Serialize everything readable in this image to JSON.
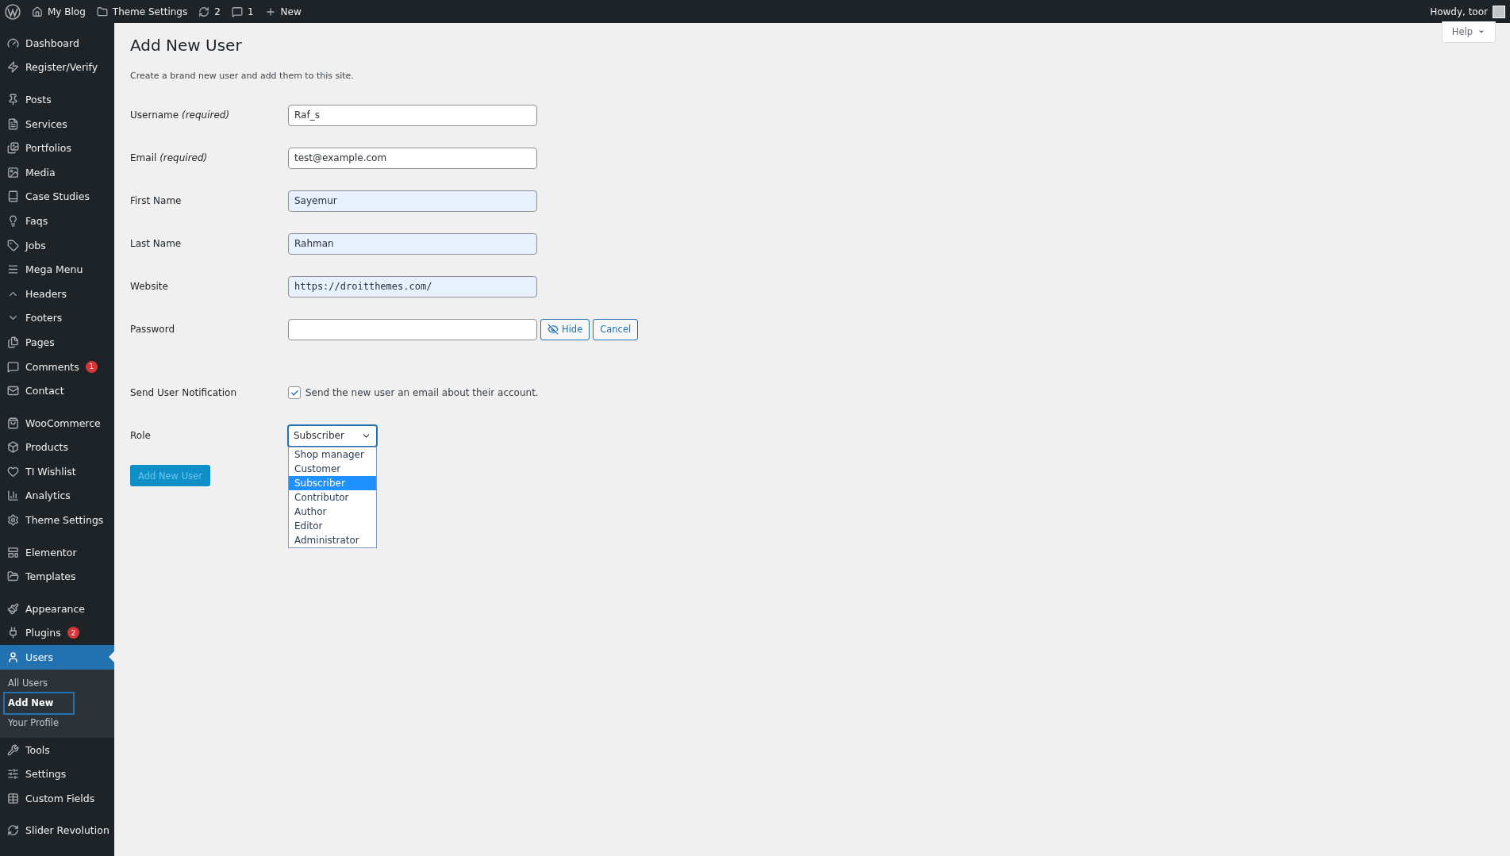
{
  "admin_bar": {
    "items": [
      {
        "kind": "home",
        "label": "My Blog"
      },
      {
        "kind": "folder",
        "label": "Theme Settings"
      },
      {
        "kind": "updates",
        "label": "2"
      },
      {
        "kind": "comments",
        "label": "1"
      },
      {
        "kind": "new",
        "label": "New"
      }
    ],
    "account": "Howdy, toor"
  },
  "help_tab": "Help",
  "sidebar": {
    "groups": [
      {
        "items": [
          {
            "kind": "gauge",
            "label": "Dashboard",
            "selected": false
          },
          {
            "kind": "bolt",
            "label": "Register/Verify",
            "selected": false
          }
        ]
      },
      {
        "items": [
          {
            "kind": "pin",
            "label": "Posts",
            "selected": false
          },
          {
            "kind": "doc",
            "label": "Services",
            "selected": false
          },
          {
            "kind": "images",
            "label": "Portfolios",
            "selected": false
          },
          {
            "kind": "media",
            "label": "Media",
            "selected": false
          },
          {
            "kind": "book",
            "label": "Case Studies",
            "selected": false
          },
          {
            "kind": "bulb",
            "label": "Faqs",
            "selected": false
          },
          {
            "kind": "tag",
            "label": "Jobs",
            "selected": false
          },
          {
            "kind": "menu",
            "label": "Mega Menu",
            "selected": false
          },
          {
            "kind": "up",
            "label": "Headers",
            "selected": false
          },
          {
            "kind": "down",
            "label": "Footers",
            "selected": false
          },
          {
            "kind": "pages",
            "label": "Pages",
            "selected": false
          },
          {
            "kind": "comment",
            "label": "Comments",
            "badge": "1",
            "selected": false
          },
          {
            "kind": "mail",
            "label": "Contact",
            "selected": false
          }
        ]
      },
      {
        "items": [
          {
            "kind": "woo",
            "label": "WooCommerce",
            "selected": false
          },
          {
            "kind": "box",
            "label": "Products",
            "selected": false
          },
          {
            "kind": "heart",
            "label": "TI Wishlist",
            "selected": false
          },
          {
            "kind": "chart",
            "label": "Analytics",
            "selected": false
          },
          {
            "kind": "gear",
            "label": "Theme Settings",
            "selected": false
          }
        ]
      },
      {
        "items": [
          {
            "kind": "layout",
            "label": "Elementor",
            "selected": false
          },
          {
            "kind": "folder",
            "label": "Templates",
            "selected": false
          }
        ]
      },
      {
        "items": [
          {
            "kind": "brush",
            "label": "Appearance",
            "selected": false
          },
          {
            "kind": "plug",
            "label": "Plugins",
            "badge": "2",
            "selected": false
          },
          {
            "kind": "user",
            "label": "Users",
            "selected": true,
            "children": [
              {
                "label": "All Users",
                "selected": false
              },
              {
                "label": "Add New",
                "selected": true
              },
              {
                "label": "Your Profile",
                "selected": false
              }
            ]
          },
          {
            "kind": "wrench",
            "label": "Tools",
            "selected": false
          },
          {
            "kind": "sliders",
            "label": "Settings",
            "selected": false
          },
          {
            "kind": "table",
            "label": "Custom Fields",
            "selected": false
          }
        ]
      },
      {
        "items": [
          {
            "kind": "refresh",
            "label": "Slider Revolution",
            "selected": false
          }
        ]
      }
    ]
  },
  "page": {
    "title": "Add New User",
    "description": "Create a brand new user and add them to this site.",
    "fields": [
      {
        "kind": "text",
        "label": "Username",
        "required": "(required)",
        "value": "Raf_s",
        "autofilled": false
      },
      {
        "kind": "text",
        "label": "Email",
        "required": "(required)",
        "value": "test@example.com",
        "autofilled": false
      },
      {
        "kind": "text",
        "label": "First Name",
        "value": "Sayemur",
        "autofilled": true
      },
      {
        "kind": "text",
        "label": "Last Name",
        "value": "Rahman",
        "autofilled": true
      },
      {
        "kind": "url",
        "label": "Website",
        "value": "https://droitthemes.com/",
        "autofilled": true
      },
      {
        "kind": "password",
        "label": "Password",
        "buttons": [
          {
            "kind": "hide",
            "label": "Hide"
          },
          {
            "kind": "cancel",
            "label": "Cancel"
          }
        ]
      },
      {
        "kind": "checkbox",
        "label": "Send User Notification",
        "text": "Send the new user an email about their account.",
        "checked": true
      },
      {
        "kind": "select",
        "label": "Role",
        "value": "Subscriber",
        "expanded": true,
        "options": [
          {
            "label": "Shop manager",
            "selected": false
          },
          {
            "label": "Customer",
            "selected": false
          },
          {
            "label": "Subscriber",
            "selected": true
          },
          {
            "label": "Contributor",
            "selected": false
          },
          {
            "label": "Author",
            "selected": false
          },
          {
            "label": "Editor",
            "selected": false
          },
          {
            "label": "Administrator",
            "selected": false
          }
        ]
      }
    ],
    "submit": {
      "label": "Add New User",
      "disabled": true
    }
  }
}
